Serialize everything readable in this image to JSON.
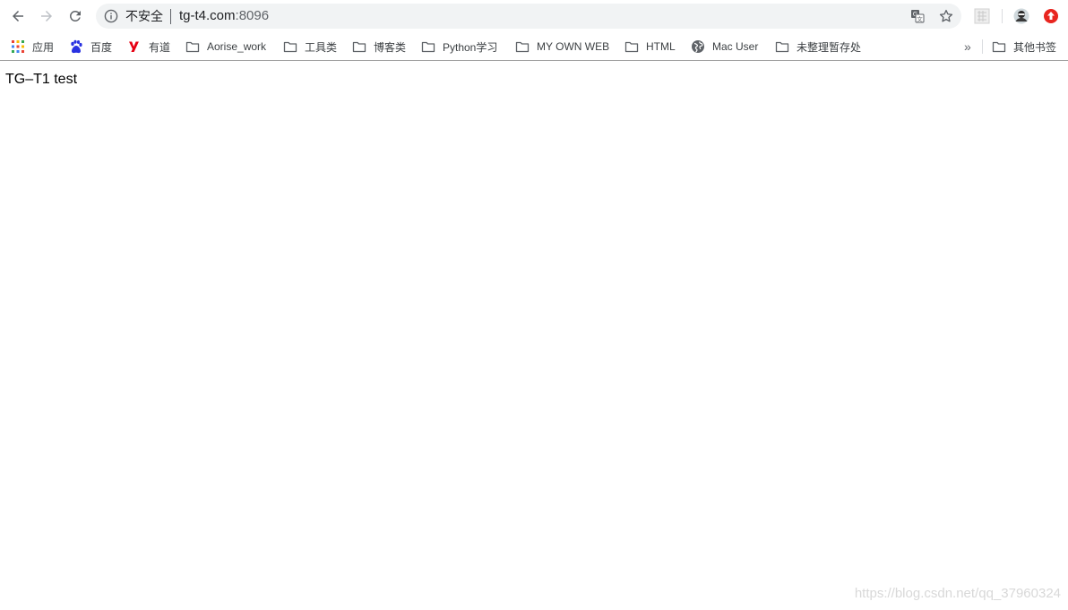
{
  "toolbar": {
    "security_label": "不安全",
    "url_host": "tg-t4.com",
    "url_port": ":8096"
  },
  "bookmarks": {
    "items": [
      {
        "label": "应用",
        "icon": "apps-grid-icon"
      },
      {
        "label": "百度",
        "icon": "baidu-paw-icon"
      },
      {
        "label": "有道",
        "icon": "youdao-icon"
      },
      {
        "label": "Aorise_work",
        "icon": "folder-icon"
      },
      {
        "label": "工具类",
        "icon": "folder-icon"
      },
      {
        "label": "博客类",
        "icon": "folder-icon"
      },
      {
        "label": "Python学习",
        "icon": "folder-icon"
      },
      {
        "label": "MY OWN WEB",
        "icon": "folder-icon"
      },
      {
        "label": "HTML",
        "icon": "folder-icon"
      },
      {
        "label": "Mac User",
        "icon": "globe-icon"
      },
      {
        "label": "未整理暂存处",
        "icon": "folder-icon"
      }
    ],
    "overflow": "»",
    "other_bookmarks": "其他书签"
  },
  "page": {
    "body_text": "TG–T1 test"
  },
  "watermark": "https://blog.csdn.net/qq_37960324",
  "colors": {
    "omnibox_bg": "#f1f3f4",
    "youdao_red": "#e60012",
    "baidu_blue": "#2932e1",
    "extension_red": "#e8251f"
  }
}
